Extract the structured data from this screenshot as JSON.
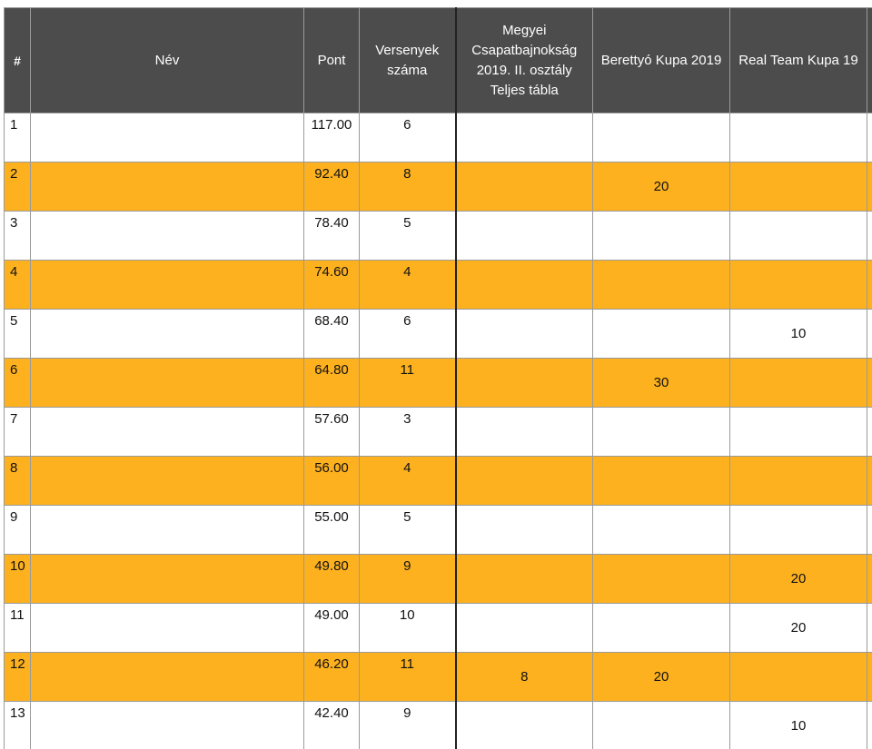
{
  "columns": {
    "rank": "#",
    "name": "Név",
    "points": "Pont",
    "events_count": "Versenyek száma",
    "comp1": "Megyei Csapatbajnokság 2019. II. osztály Teljes tábla",
    "comp2": "Berettyó Kupa 2019",
    "comp3": "Real Team Kupa 19",
    "comp4": ""
  },
  "rows": [
    {
      "rank": "1",
      "name": "",
      "points": "117.00",
      "count": "6",
      "c1": "",
      "c2": "",
      "c3": "",
      "c4": ""
    },
    {
      "rank": "2",
      "name": "",
      "points": "92.40",
      "count": "8",
      "c1": "",
      "c2": "20",
      "c3": "",
      "c4": ""
    },
    {
      "rank": "3",
      "name": "",
      "points": "78.40",
      "count": "5",
      "c1": "",
      "c2": "",
      "c3": "",
      "c4": ""
    },
    {
      "rank": "4",
      "name": "",
      "points": "74.60",
      "count": "4",
      "c1": "",
      "c2": "",
      "c3": "",
      "c4": ""
    },
    {
      "rank": "5",
      "name": "",
      "points": "68.40",
      "count": "6",
      "c1": "",
      "c2": "",
      "c3": "10",
      "c4": ""
    },
    {
      "rank": "6",
      "name": "",
      "points": "64.80",
      "count": "11",
      "c1": "",
      "c2": "30",
      "c3": "",
      "c4": ""
    },
    {
      "rank": "7",
      "name": "",
      "points": "57.60",
      "count": "3",
      "c1": "",
      "c2": "",
      "c3": "",
      "c4": ""
    },
    {
      "rank": "8",
      "name": "",
      "points": "56.00",
      "count": "4",
      "c1": "",
      "c2": "",
      "c3": "",
      "c4": ""
    },
    {
      "rank": "9",
      "name": "",
      "points": "55.00",
      "count": "5",
      "c1": "",
      "c2": "",
      "c3": "",
      "c4": ""
    },
    {
      "rank": "10",
      "name": "",
      "points": "49.80",
      "count": "9",
      "c1": "",
      "c2": "",
      "c3": "20",
      "c4": ""
    },
    {
      "rank": "11",
      "name": "",
      "points": "49.00",
      "count": "10",
      "c1": "",
      "c2": "",
      "c3": "20",
      "c4": ""
    },
    {
      "rank": "12",
      "name": "",
      "points": "46.20",
      "count": "11",
      "c1": "8",
      "c2": "20",
      "c3": "",
      "c4": ""
    },
    {
      "rank": "13",
      "name": "",
      "points": "42.40",
      "count": "9",
      "c1": "",
      "c2": "",
      "c3": "10",
      "c4": ""
    }
  ],
  "colors": {
    "header_bg": "#4c4c4c",
    "header_text": "#ffffff",
    "row_highlight": "#fdb11e",
    "row_plain": "#ffffff",
    "grid": "#9a9a9a"
  }
}
